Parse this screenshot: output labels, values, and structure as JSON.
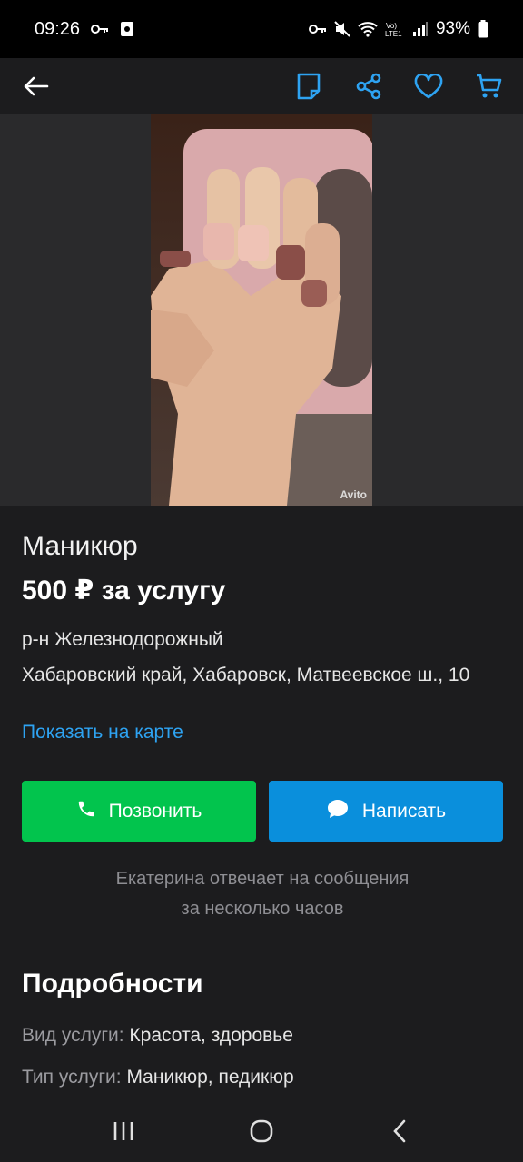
{
  "status_bar": {
    "time": "09:26",
    "battery": "93%"
  },
  "app_bar": {
    "icons": [
      "back-arrow-icon",
      "note-icon",
      "share-icon",
      "heart-icon",
      "cart-icon"
    ],
    "accent_color": "#2ea3f2"
  },
  "photo": {
    "watermark": "Avito"
  },
  "listing": {
    "title": "Маникюр",
    "price": "500 ₽ за услугу",
    "district": "р-н Железнодорожный",
    "address": "Хабаровский край, Хабаровск, Матвеевское ш., 10",
    "map_link": "Показать на карте"
  },
  "actions": {
    "call_label": "Позвонить",
    "write_label": "Написать",
    "call_color": "#02c44d",
    "write_color": "#0a8fdc"
  },
  "reply_note": {
    "line1": "Екатерина отвечает на сообщения",
    "line2": "за несколько часов"
  },
  "details": {
    "title": "Подробности",
    "params": [
      {
        "key": "Вид услуги:",
        "value": "Красота, здоровье"
      },
      {
        "key": "Тип услуги:",
        "value": "Маникюр, педикюр"
      }
    ]
  }
}
